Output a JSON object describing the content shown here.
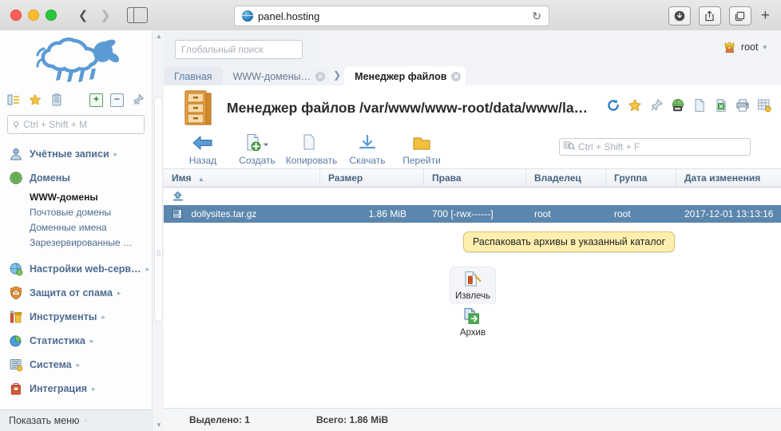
{
  "browser": {
    "url": "panel.hosting",
    "back_icon": "back-chevron-icon",
    "forward_icon": "forward-chevron-icon",
    "sidebar_icon": "sidebar-toggle-icon",
    "reload_icon": "reload-icon",
    "downloads_icon": "downloads-icon",
    "share_icon": "share-icon",
    "tabs_icon": "show-tabs-icon",
    "new_tab_icon": "new-tab-icon"
  },
  "sidebar": {
    "logo_alt": "sheep-logo",
    "toolbar_icons": [
      "tree-view-icon",
      "star-icon",
      "clipboard-icon",
      "expand-all-icon",
      "collapse-all-icon",
      "pin-icon"
    ],
    "search": {
      "placeholder": "Ctrl + Shift + M",
      "icon": "search-icon"
    },
    "items": [
      {
        "label": "Учётные записи",
        "icon": "user-icon",
        "arrow": "▸"
      },
      {
        "label": "Домены",
        "icon": "globe-icon",
        "arrow": ""
      },
      {
        "label": "Настройки web-серв…",
        "icon": "web-settings-icon",
        "arrow": "▸"
      },
      {
        "label": "Защита от спама",
        "icon": "spam-shield-icon",
        "arrow": "▸"
      },
      {
        "label": "Инструменты",
        "icon": "tools-icon",
        "arrow": "▸"
      },
      {
        "label": "Статистика",
        "icon": "pie-chart-icon",
        "arrow": "▸"
      },
      {
        "label": "Система",
        "icon": "system-icon",
        "arrow": "▸"
      },
      {
        "label": "Интеграция",
        "icon": "integration-icon",
        "arrow": "▸"
      }
    ],
    "domains_sub": [
      {
        "label": "WWW-домены",
        "active": true
      },
      {
        "label": "Почтовые домены",
        "active": false
      },
      {
        "label": "Доменные имена",
        "active": false
      },
      {
        "label": "Зарезервированные …",
        "active": false
      }
    ],
    "show_menu": "Показать меню",
    "show_menu_arrow": "·"
  },
  "header": {
    "global_search_placeholder": "Глобальный поиск",
    "user_name": "root",
    "user_icon": "crown-user-icon",
    "user_caret": "▾"
  },
  "tabs": [
    {
      "label": "Главная",
      "closable": false,
      "active": false
    },
    {
      "label": "WWW-домены…",
      "closable": true,
      "active": false
    },
    {
      "label": "Менеджер файлов",
      "closable": true,
      "active": true
    }
  ],
  "page": {
    "title": "Менеджер файлов /var/www/www-root/data/www/la…",
    "icon": "file-cabinet-icon",
    "head_icons": [
      "refresh-icon",
      "star-icon",
      "pin-icon",
      "web-icon",
      "document-icon",
      "excel-icon",
      "print-icon",
      "table-settings-icon"
    ]
  },
  "toolbar": {
    "buttons": [
      {
        "label": "Назад",
        "icon": "back-arrow-icon",
        "has_caret": false
      },
      {
        "label": "Создать",
        "icon": "new-file-icon",
        "has_caret": true
      },
      {
        "label": "Копировать",
        "icon": "copy-icon",
        "has_caret": false
      },
      {
        "label": "Скачать",
        "icon": "download-icon",
        "has_caret": false
      },
      {
        "label": "Перейти",
        "icon": "goto-icon",
        "has_caret": false
      }
    ],
    "search": {
      "placeholder": "Ctrl + Shift + F",
      "icon": "table-search-icon"
    }
  },
  "tooltip": {
    "text": "Распаковать архивы в указанный каталог"
  },
  "dropdown": {
    "items": [
      {
        "label": "Извлечь",
        "icon": "extract-archive-icon",
        "highlighted": true
      },
      {
        "label": "Архив",
        "icon": "create-archive-icon",
        "highlighted": false
      }
    ]
  },
  "table": {
    "columns": [
      {
        "key": "name",
        "label": "Имя",
        "sorted": "asc",
        "sort_glyph": "▲"
      },
      {
        "key": "size",
        "label": "Размер"
      },
      {
        "key": "perm",
        "label": "Права"
      },
      {
        "key": "owner",
        "label": "Владелец"
      },
      {
        "key": "group",
        "label": "Группа"
      },
      {
        "key": "date",
        "label": "Дата изменения"
      }
    ],
    "parent_row": {
      "icon": "parent-directory-icon",
      "name": ""
    },
    "rows": [
      {
        "icon": "archive-file-icon",
        "name": "dollysites.tar.gz",
        "size": "1.86 MiB",
        "perm": "700 [-rwx------]",
        "owner": "root",
        "group": "root",
        "date": "2017-12-01 13:13:16",
        "selected": true
      }
    ]
  },
  "status": {
    "selected": "Выделено: 1",
    "total": "Всего: 1.86 MiB"
  },
  "colors": {
    "accent": "#4d6b91",
    "selection": "#5b86ad",
    "tooltip_bg": "#ffefaf",
    "link": "#5b7ba4"
  }
}
